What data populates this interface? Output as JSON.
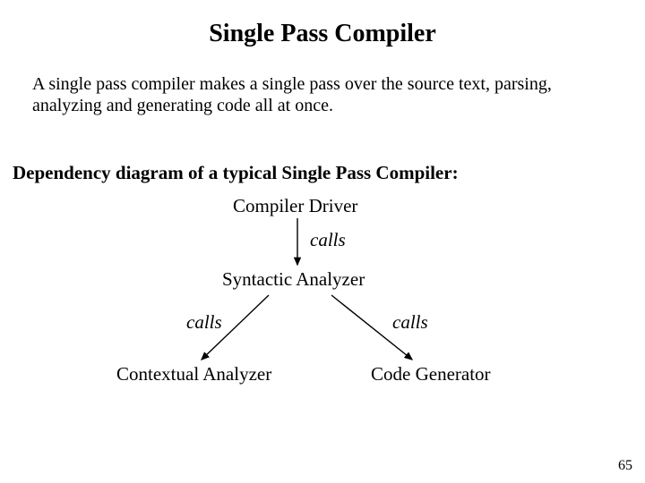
{
  "title": "Single Pass Compiler",
  "intro": "A single pass compiler makes a single pass over the source text, parsing, analyzing and generating code all at once.",
  "subheading": "Dependency diagram of a typical Single Pass Compiler:",
  "diagram": {
    "nodes": {
      "root": "Compiler Driver",
      "mid": "Syntactic Analyzer",
      "leftLeaf": "Contextual Analyzer",
      "rightLeaf": "Code Generator"
    },
    "edges": {
      "rootToMid": "calls",
      "midToLeft": "calls",
      "midToRight": "calls"
    }
  },
  "pageNumber": "65"
}
